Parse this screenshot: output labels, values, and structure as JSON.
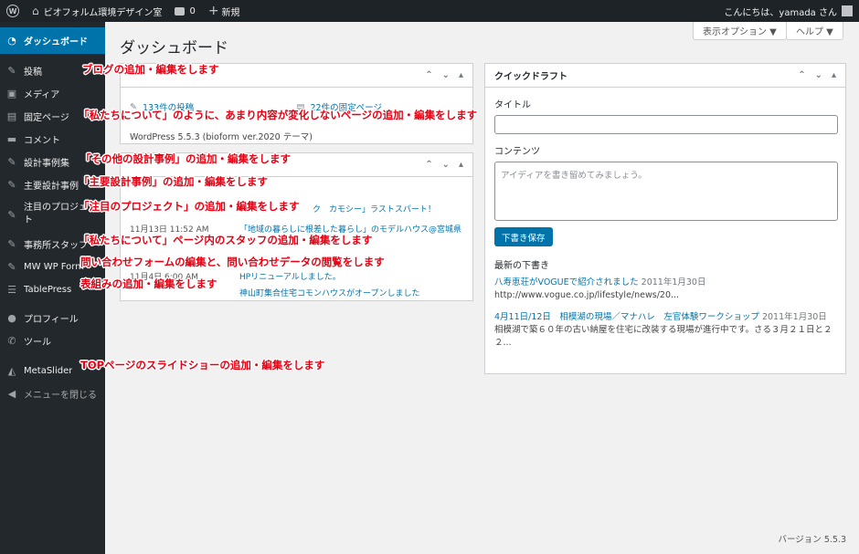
{
  "adminbar": {
    "site_name": "ビオフォルム環境デザイン室",
    "comments_count": "0",
    "new_label": "新規",
    "greeting": "こんにちは、yamada さん"
  },
  "sidebar": {
    "items": [
      {
        "label": "ダッシュボード",
        "icon": "dashboard-icon"
      },
      {
        "label": "投稿",
        "icon": "pin-icon"
      },
      {
        "label": "メディア",
        "icon": "media-icon"
      },
      {
        "label": "固定ページ",
        "icon": "page-icon"
      },
      {
        "label": "コメント",
        "icon": "comment-icon"
      },
      {
        "label": "設計事例集",
        "icon": "pin-icon"
      },
      {
        "label": "主要設計事例",
        "icon": "pin-icon"
      },
      {
        "label": "注目のプロジェクト",
        "icon": "pin-icon"
      },
      {
        "label": "事務所スタッフ",
        "icon": "pin-icon"
      },
      {
        "label": "MW WP Form",
        "icon": "pin-icon"
      },
      {
        "label": "TablePress",
        "icon": "table-icon"
      },
      {
        "label": "プロフィール",
        "icon": "user-icon"
      },
      {
        "label": "ツール",
        "icon": "wrench-icon"
      },
      {
        "label": "MetaSlider",
        "icon": "metaslider-icon"
      },
      {
        "label": "メニューを閉じる",
        "icon": "collapse-icon"
      }
    ]
  },
  "main": {
    "title": "ダッシュボード",
    "screen_options": "表示オプション ▼",
    "help": "ヘルプ ▼",
    "glance": {
      "posts": "133件の投稿",
      "pages": "22件の固定ページ",
      "wp_version": "WordPress 5.5.3 (bioform ver.2020 テーマ)"
    },
    "activity": {
      "rows": [
        {
          "date": "",
          "link": "ク　カモシー」ラストスパート！"
        },
        {
          "date": "11月13日 11:52 AM",
          "link": "「地域の暮らしに根差した暮らし」のモデルハウス@宮城県"
        },
        {
          "date": "11月4日 6:00 AM",
          "link": "HPリニューアルしました。"
        },
        {
          "date": "",
          "link": "神山町集合住宅コモンハウスがオープンしました"
        }
      ]
    },
    "quick_draft": {
      "title": "クイックドラフト",
      "title_label": "タイトル",
      "content_label": "コンテンツ",
      "content_placeholder": "アイディアを書き留めてみましょう。",
      "save_button": "下書き保存",
      "drafts_title": "最新の下書き",
      "drafts": [
        {
          "link": "八寿恵荘がVOGUEで紹介されました",
          "date": "2011年1月30日",
          "excerpt": "http://www.vogue.co.jp/lifestyle/news/20..."
        },
        {
          "link": "4月11日/12日　相模湖の現場／マナハレ　左官体験ワークショップ",
          "date": "2011年1月30日",
          "excerpt": "相模湖で築６０年の古い納屋を住宅に改装する現場が進行中です。さる３月２１日と２２..."
        }
      ]
    },
    "footer_version": "バージョン 5.5.3"
  },
  "annotations": {
    "posts": "ブログの追加・編集をします",
    "pages": "「私たちについて」のように、あまり内容が変化しないページの追加・編集をします",
    "cases": "「その他の設計事例」の追加・編集をします",
    "main_cases": "「主要設計事例」の追加・編集をします",
    "projects": "「注目のプロジェクト」の追加・編集をします",
    "staff": "「私たちについて」ページ内のスタッフの追加・編集をします",
    "form": "問い合わせフォームの編集と、問い合わせデータの閲覧をします",
    "table": "表組みの追加・編集をします",
    "slider": "TOPページのスライドショーの追加・編集をします"
  }
}
